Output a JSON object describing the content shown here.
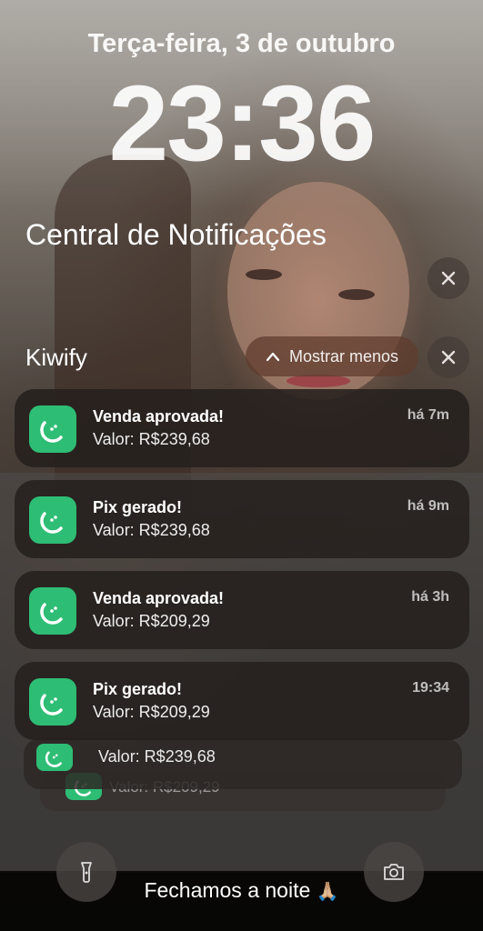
{
  "lockscreen": {
    "date": "Terça-feira, 3 de outubro",
    "time": "23:36"
  },
  "notification_center": {
    "title": "Central de Notificações",
    "group_app": "Kiwify",
    "show_less_label": "Mostrar menos"
  },
  "notifications": [
    {
      "title": "Venda aprovada!",
      "body": "Valor: R$239,68",
      "time": "há 7m"
    },
    {
      "title": "Pix gerado!",
      "body": "Valor: R$239,68",
      "time": "há 9m"
    },
    {
      "title": "Venda aprovada!",
      "body": "Valor: R$209,29",
      "time": "há 3h"
    },
    {
      "title": "Pix gerado!",
      "body": "Valor: R$209,29",
      "time": "19:34"
    }
  ],
  "stacked": [
    {
      "body": "Valor: R$239,68"
    },
    {
      "body": "Valor: R$209,29"
    }
  ],
  "caption": {
    "text": "Fechamos a noite",
    "emoji": "🙏🏼"
  },
  "colors": {
    "app_icon": "#2ebd74",
    "show_less_bg": "#5f3c2d"
  },
  "icons": [
    "close-icon",
    "chevron-up-icon",
    "kiwify-app-icon",
    "flashlight-icon",
    "camera-icon",
    "praying-hands-emoji"
  ]
}
